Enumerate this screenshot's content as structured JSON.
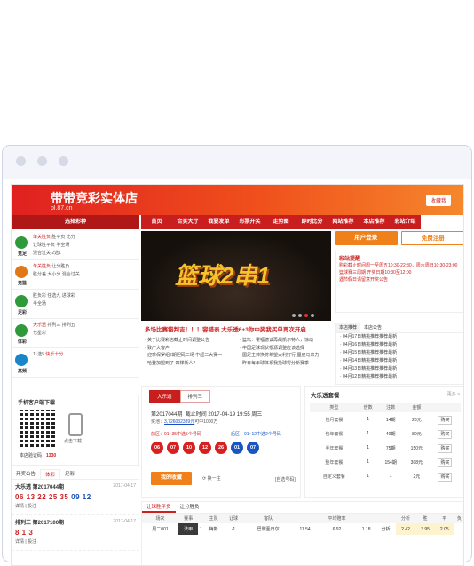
{
  "header": {
    "title": "带带竞彩实体店",
    "subtitle": "pl.87.cn",
    "favorite": "收藏我"
  },
  "nav": {
    "select": "选择彩种",
    "items": [
      "首页",
      "合买大厅",
      "我要发单",
      "彩票开奖",
      "走势图",
      "即时比分",
      "网站推荐",
      "本店推荐",
      "彩站介绍"
    ]
  },
  "games": [
    {
      "name": "竞足",
      "color": "#2e9a3a",
      "lines": [
        [
          {
            "t": "单关胜负",
            "r": true
          },
          {
            "t": "  胜平负  比分"
          }
        ],
        [
          {
            "t": "让球胜平负  半全场"
          }
        ],
        [
          {
            "t": "混合过关  2选1"
          }
        ]
      ]
    },
    {
      "name": "竞篮",
      "color": "#e07818",
      "lines": [
        [
          {
            "t": "单关胜负",
            "r": true
          },
          {
            "t": "  让分胜负"
          }
        ],
        [
          {
            "t": "胜分差  大小分  混合过关"
          }
        ]
      ]
    },
    {
      "name": "足彩",
      "color": "#2e9a3a",
      "lines": [
        [
          {
            "t": "胜负彩  任选九  进球彩"
          }
        ],
        [
          {
            "t": "半全场"
          }
        ]
      ]
    },
    {
      "name": "体彩",
      "color": "#2e9a3a",
      "lines": [
        [
          {
            "t": "大乐透",
            "r": true
          },
          {
            "t": "  排列三  排列五"
          }
        ],
        [
          {
            "t": "七星彩"
          }
        ]
      ]
    },
    {
      "name": "高频",
      "color": "#1a86c8",
      "lines": [
        [
          {
            "t": "11选5"
          },
          {
            "t": "  快乐十分",
            "r": true
          }
        ]
      ]
    }
  ],
  "app": {
    "title": "手机客户端下载",
    "click": "点击下载",
    "count_label": "本店验证码：",
    "count": "1330"
  },
  "draw": {
    "tabs": [
      "开奖公告",
      "体彩",
      "足彩"
    ],
    "items": [
      {
        "name": "大乐透 第2017044期",
        "date": "2017-04-17",
        "reds": "06 13 22 25 35",
        "blues": "09 12",
        "links": "详情  |  投注"
      },
      {
        "name": "排列三 第2017100期",
        "date": "2017-04-17",
        "reds": "8 1 3",
        "blues": "",
        "links": "详情  |  投注"
      }
    ]
  },
  "banner": {
    "text": "篮球2串1"
  },
  "news": {
    "headline": "多场比赛错判吉！！！容错表    大乐透6+3你中奖我买单再次开启",
    "items": [
      "· 关于比赛彩店截止时间调整公告",
      "· 篮坛：霍福德谈再战凯尔特人，惊动",
      "· 致广大客户",
      "· 中国足球现状根源调整应该选择",
      "· 迎季保罗组6期胆码三场 中超三大赛一",
      "· 国足主帅换将希望大利好行 里皮马来力",
      "· 哈登加盟到了 四样新人？",
      "· 昨日每年球体系我抢球得分新赛季"
    ]
  },
  "right": {
    "register": "用户登录",
    "free": "免费注册",
    "notice_title": "彩站提醒",
    "notice": [
      "购彩截止时间周一至周五10:30-22:30，周六周日10:30-23:00",
      "篮球赛三周期 开奖日期10:30至12:00",
      "遇节假日请留意开奖公告"
    ],
    "rtabs": [
      "本店推荐",
      "本店公告"
    ],
    "rnews": [
      "· 04月17日精挑推荐推荐最新",
      "· 04月16日精挑推荐推荐最新",
      "· 04月15日精挑推荐推荐最新",
      "· 04月14日精挑推荐推荐最新",
      "· 04月13日精挑推荐推荐最新",
      "· 04月12日精挑推荐推荐最新"
    ]
  },
  "buy": {
    "tabs": [
      "大乐透",
      "排列三"
    ],
    "issue": "第2017044期",
    "deadline": "截止时间 2017-04-19  19:55  周三",
    "pool_label": "奖池：",
    "pool": "3,726032389元",
    "pool_tail": "可中1000万",
    "front_label": "前区：01~35中选5个号码",
    "back_label": "后区：01~12中选2个号码",
    "reds": [
      "06",
      "07",
      "10",
      "12",
      "26"
    ],
    "blues": [
      "01",
      "07"
    ],
    "go": "我的收藏",
    "switch": "换一注",
    "select": "[自选号码]"
  },
  "pack": {
    "title": "大乐透套餐",
    "more": "更多 >",
    "headers": [
      "类型",
      "倍数",
      "注数",
      "金额",
      ""
    ],
    "rows": [
      [
        "包月套餐",
        "1",
        "14期",
        "28元",
        "购买"
      ],
      [
        "包年套餐",
        "1",
        "40期",
        "80元",
        "购买"
      ],
      [
        "半年套餐",
        "1",
        "75期",
        "150元",
        "购买"
      ],
      [
        "整年套餐",
        "1",
        "154期",
        "308元",
        "购买"
      ],
      [
        "自定义套餐",
        "1",
        "1",
        "2元",
        "购买"
      ]
    ]
  },
  "match": {
    "tabs": [
      "让球胜平负",
      "让分胜负"
    ],
    "headers": [
      "场次",
      "赛事",
      "",
      "主队",
      "让球",
      "客队",
      "",
      "平均赔率",
      "",
      "",
      "分析",
      "胜",
      "平",
      "负"
    ],
    "row": [
      "周二001",
      "法甲",
      "1",
      "梅斯",
      "-1",
      "巴黎圣日尔",
      "11.54",
      "6.92",
      "1.18",
      "分析",
      "2.42",
      "3.95",
      "2.05"
    ]
  }
}
